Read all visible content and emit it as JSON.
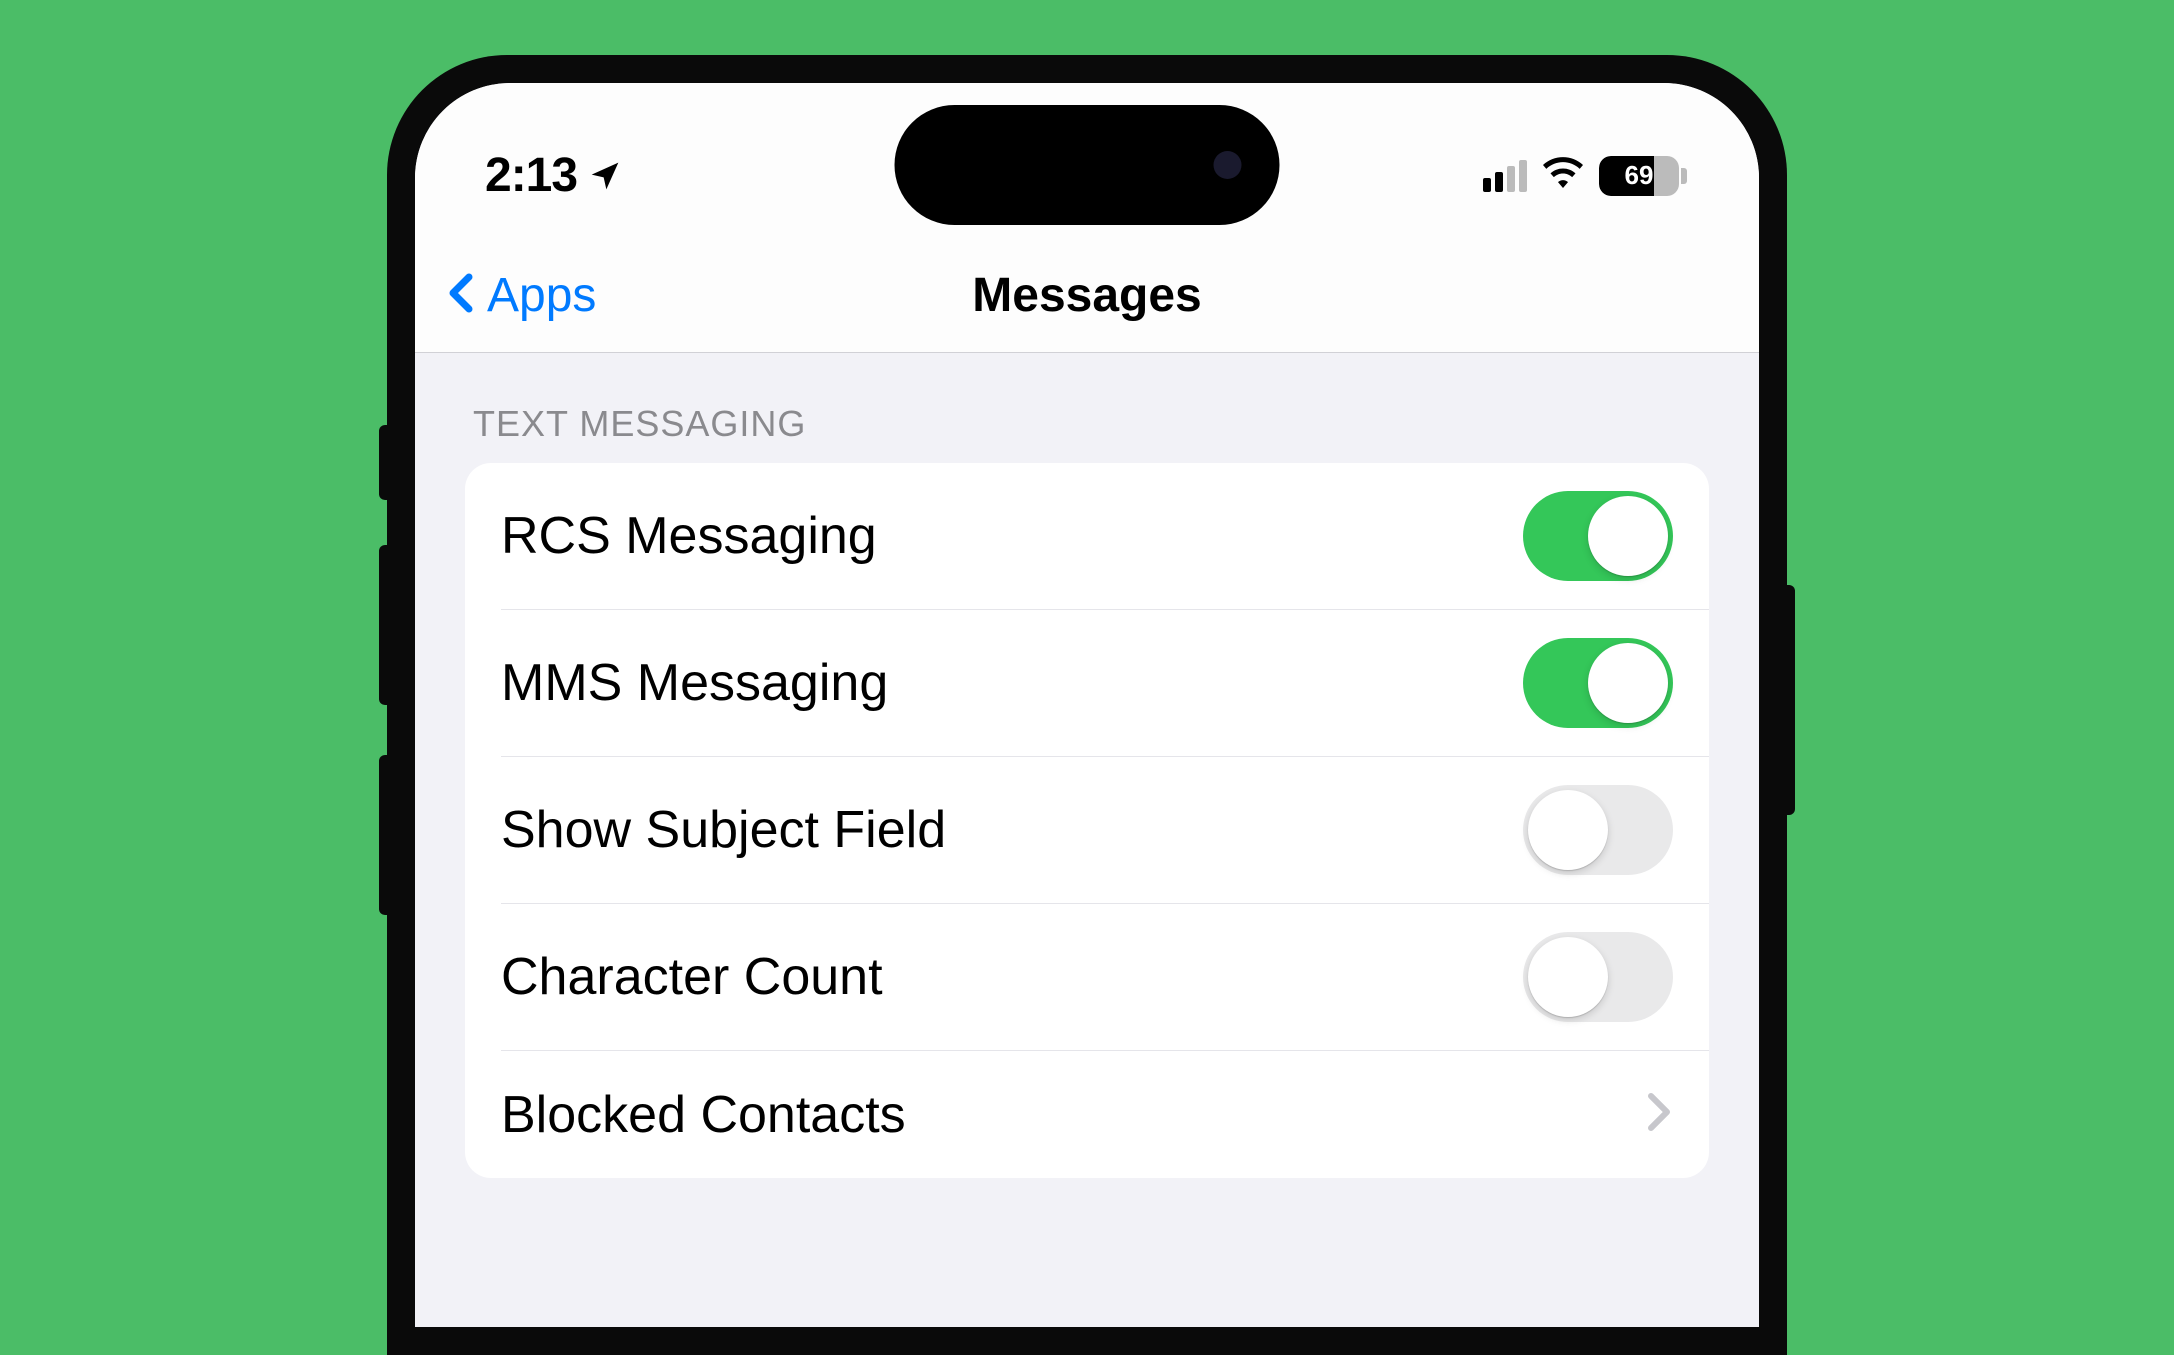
{
  "status": {
    "time": "2:13",
    "battery_level": "69"
  },
  "nav": {
    "back_label": "Apps",
    "title": "Messages"
  },
  "section": {
    "header": "TEXT MESSAGING",
    "items": [
      {
        "label": "RCS Messaging",
        "type": "toggle",
        "on": true
      },
      {
        "label": "MMS Messaging",
        "type": "toggle",
        "on": true
      },
      {
        "label": "Show Subject Field",
        "type": "toggle",
        "on": false
      },
      {
        "label": "Character Count",
        "type": "toggle",
        "on": false
      },
      {
        "label": "Blocked Contacts",
        "type": "nav"
      }
    ]
  }
}
